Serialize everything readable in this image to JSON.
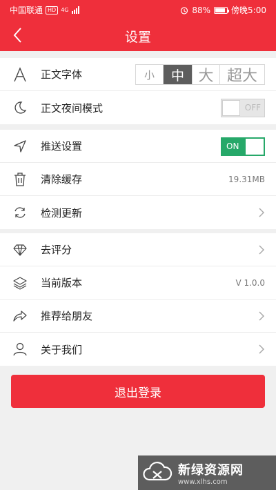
{
  "status_bar": {
    "carrier": "中国联通",
    "network_badge": "HD",
    "network_type": "4G",
    "alarm_icon": "alarm-clock-icon",
    "battery_percent": "88%",
    "battery_level": 0.88,
    "time": "傍晚5:00"
  },
  "header": {
    "back_icon": "chevron-left-icon",
    "title": "设置",
    "background_color": "#ef2f3b"
  },
  "settings": {
    "font_size": {
      "label": "正文字体",
      "icon": "letter-a-icon",
      "options": [
        "小",
        "中",
        "大",
        "超大"
      ],
      "selected": "中"
    },
    "night_mode": {
      "label": "正文夜间模式",
      "icon": "moon-icon",
      "state": "OFF"
    },
    "push": {
      "label": "推送设置",
      "icon": "navigation-arrow-icon",
      "state": "ON"
    },
    "clear_cache": {
      "label": "清除缓存",
      "icon": "trash-icon",
      "value": "19.31MB"
    },
    "check_update": {
      "label": "检测更新",
      "icon": "refresh-icon"
    },
    "rate": {
      "label": "去评分",
      "icon": "diamond-icon"
    },
    "version": {
      "label": "当前版本",
      "icon": "layers-icon",
      "value": "V 1.0.0"
    },
    "recommend": {
      "label": "推荐给朋友",
      "icon": "share-arrow-icon"
    },
    "about": {
      "label": "关于我们",
      "icon": "person-icon"
    }
  },
  "logout_label": "退出登录",
  "watermark": {
    "title": "新绿资源网",
    "url": "www.xlhs.com"
  },
  "colors": {
    "accent": "#ef2f3b",
    "toggle_on": "#26a869"
  }
}
